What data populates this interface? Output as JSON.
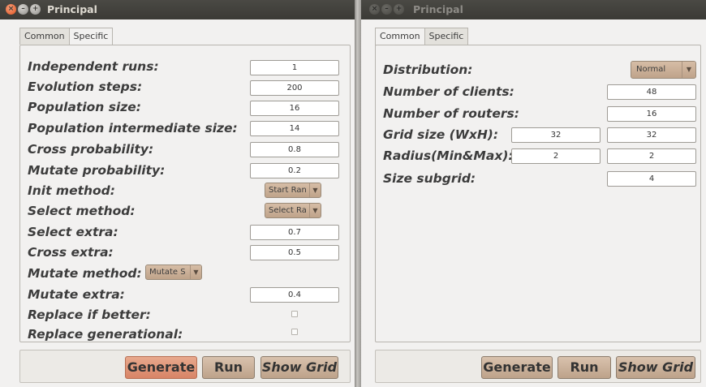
{
  "left": {
    "title": "Principal",
    "tabs": {
      "common": "Common",
      "specific": "Specific"
    },
    "fields": {
      "independent_runs": {
        "label": "Independent runs:",
        "value": "1"
      },
      "evolution_steps": {
        "label": "Evolution steps:",
        "value": "200"
      },
      "population_size": {
        "label": "Population size:",
        "value": "16"
      },
      "population_intermediate_size": {
        "label": "Population intermediate size:",
        "value": "14"
      },
      "cross_probability": {
        "label": "Cross probability:",
        "value": "0.8"
      },
      "mutate_probability": {
        "label": "Mutate probability:",
        "value": "0.2"
      },
      "init_method": {
        "label": "Init method:",
        "value": "Start Ran"
      },
      "select_method": {
        "label": "Select method:",
        "value": "Select Ra"
      },
      "select_extra": {
        "label": "Select extra:",
        "value": "0.7"
      },
      "cross_extra": {
        "label": "Cross extra:",
        "value": "0.5"
      },
      "mutate_method": {
        "label": "Mutate method:",
        "value": "Mutate S"
      },
      "mutate_extra": {
        "label": "Mutate extra:",
        "value": "0.4"
      },
      "replace_if_better": {
        "label": "Replace if better:",
        "checked": false
      },
      "replace_generational": {
        "label": "Replace generational:",
        "checked": false
      }
    },
    "buttons": {
      "generate": "Generate",
      "run": "Run",
      "show_grid": "Show Grid"
    }
  },
  "right": {
    "title": "Principal",
    "tabs": {
      "common": "Common",
      "specific": "Specific"
    },
    "fields": {
      "distribution": {
        "label": "Distribution:",
        "value": "Normal"
      },
      "number_of_clients": {
        "label": "Number of clients:",
        "value": "48"
      },
      "number_of_routers": {
        "label": "Number of routers:",
        "value": "16"
      },
      "grid_size": {
        "label": "Grid size (WxH):",
        "w": "32",
        "h": "32"
      },
      "radius": {
        "label": "Radius(Min&Max):",
        "min": "2",
        "max": "2"
      },
      "size_subgrid": {
        "label": "Size subgrid:",
        "value": "4"
      }
    },
    "buttons": {
      "generate": "Generate",
      "run": "Run",
      "show_grid": "Show Grid"
    }
  },
  "icons": {
    "close": "close-icon",
    "minimize": "minimize-icon",
    "maximize": "maximize-icon",
    "dropdown": "chevron-down-icon"
  },
  "colors": {
    "titlebar": "#3b3a36",
    "close_button": "#e2531f",
    "highlight_button": "#d88466",
    "button": "#bda28a"
  }
}
